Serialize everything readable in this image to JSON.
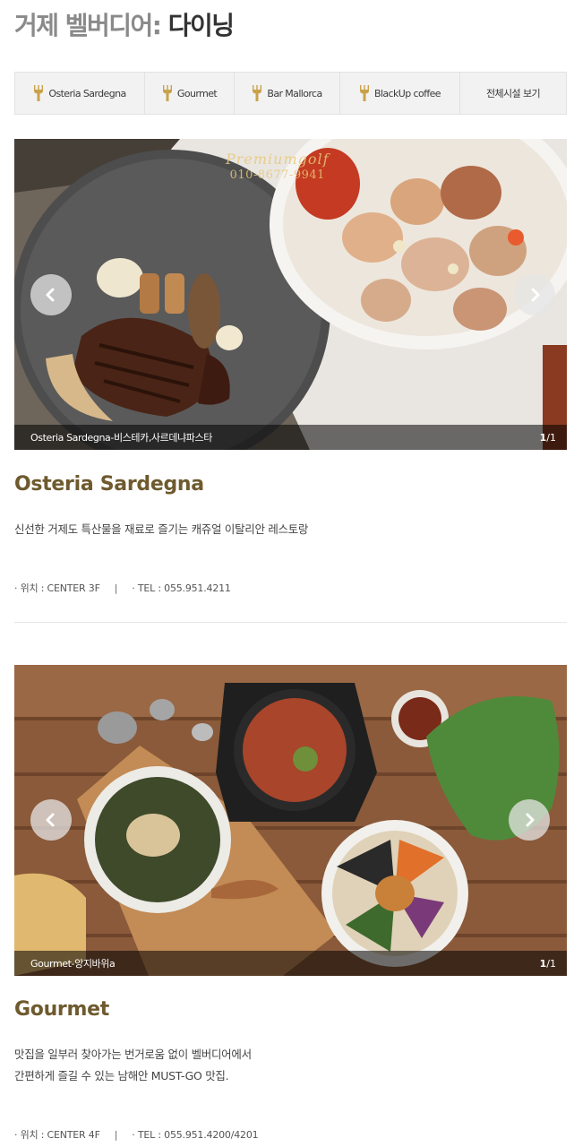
{
  "page": {
    "title_light": "거제 벨버디어:",
    "title_bold": "다이닝"
  },
  "tabs": [
    {
      "label": "Osteria Sardegna",
      "icon": "utensils-icon"
    },
    {
      "label": "Gourmet",
      "icon": "utensils-icon"
    },
    {
      "label": "Bar Mallorca",
      "icon": "utensils-icon"
    },
    {
      "label": "BlackUp coffee",
      "icon": "utensils-icon"
    },
    {
      "label": "전체시설 보기"
    }
  ],
  "watermark": {
    "name": "Premiumgolf",
    "phone": "010-8677-9941"
  },
  "venues": [
    {
      "caption": "Osteria Sardegna-비스테카,사르데냐파스타",
      "counter_current": "1",
      "counter_total": "/1",
      "title": "Osteria Sardegna",
      "description": [
        "신선한 거제도 특산물을 재료로 즐기는 캐쥬얼 이탈리안 레스토랑"
      ],
      "location": "· 위치 : CENTER 3F",
      "separator": "|",
      "tel": "· TEL : 055.951.4211"
    },
    {
      "caption": "Gourmet-앙지바위a",
      "counter_current": "1",
      "counter_total": "/1",
      "title": "Gourmet",
      "description": [
        "맛집을 일부러 찾아가는 번거로움 없이 벨버디어에서",
        "간편하게 즐길 수 있는 남해안 MUST-GO 맛집."
      ],
      "location": "· 위치 : CENTER 4F",
      "separator": "|",
      "tel": "· TEL : 055.951.4200/4201"
    }
  ]
}
